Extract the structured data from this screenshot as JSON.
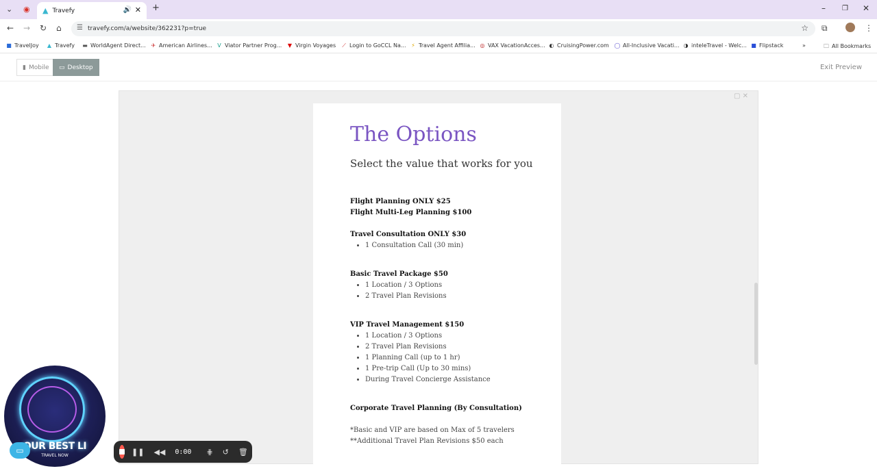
{
  "browser": {
    "tab_title": "Travefy",
    "url": "travefy.com/a/website/362231?p=true",
    "bookmarks": [
      "TravelJoy",
      "Travefy",
      "WorldAgent Direct...",
      "American Airlines...",
      "Viator Partner Prog...",
      "Virgin Voyages",
      "Login to GoCCL Na...",
      "Travel Agent Affilia...",
      "VAX VacationAcces...",
      "CruisingPower.com",
      "All-Inclusive Vacati...",
      "inteleTravel - Welc...",
      "Flipstack"
    ],
    "all_bookmarks": "All Bookmarks"
  },
  "preview": {
    "mobile_label": "Mobile",
    "desktop_label": "Desktop",
    "exit_label": "Exit Preview"
  },
  "content": {
    "title": "The Options",
    "subtitle": "Select the value that works for you",
    "flight_only": "Flight Planning ONLY $25",
    "flight_multi": "Flight Multi-Leg Planning $100",
    "consult_title": "Travel Consultation ONLY $30",
    "consult_items": [
      "1 Consultation Call (30 min)"
    ],
    "basic_title": "Basic Travel Package $50",
    "basic_items": [
      "1 Location / 3 Options",
      "2 Travel Plan Revisions"
    ],
    "vip_title": "VIP Travel Management $150",
    "vip_items": [
      "1 Location / 3 Options",
      "2 Travel Plan Revisions",
      "1 Planning Call (up to 1 hr)",
      "1 Pre-trip Call (Up to 30 mins)",
      "During Travel Concierge Assistance"
    ],
    "corporate_title": "Corporate Travel Planning (By Consultation)",
    "note1": "*Basic and VIP are based on Max of 5 travelers",
    "note2": "**Additional Travel Plan Revisions $50 each"
  },
  "overlay": {
    "logo_text": "OUR BEST LI",
    "logo_sub": "TRAVEL NOW",
    "recorder_time": "0:00"
  }
}
